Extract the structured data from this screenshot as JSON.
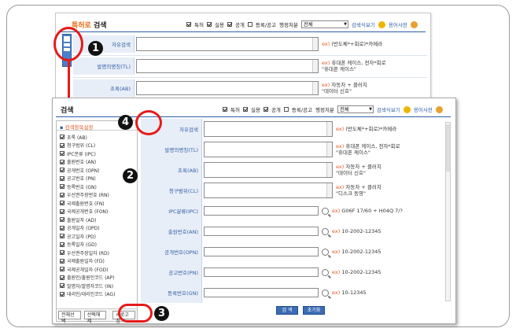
{
  "back_window": {
    "logo": "특허로",
    "title": "검색",
    "options": {
      "opt1": "특허",
      "opt2": "실용",
      "opt3": "공개",
      "opt4": "등록/공고",
      "status_label": "행정처분",
      "status_value": "전체"
    },
    "link1": "검색식보기",
    "link2": "용어사전",
    "fields": [
      {
        "label": "자유검색",
        "hint": "(반도체*+회로)*카메라",
        "sub": ""
      },
      {
        "label": "발명의명칭(TL)",
        "hint": "휴대폰 케이스, 전자*회로",
        "sub": "\"휴대폰 케이스\""
      },
      {
        "label": "초록(AB)",
        "hint": "자동차 + 클러치",
        "sub": "\"데이터 신호\""
      }
    ]
  },
  "front_window": {
    "title": "검색",
    "options": {
      "opt1": "특허",
      "opt2": "실용",
      "opt3": "공개",
      "opt4": "등록/공고",
      "status_label": "행정처분",
      "status_value": "전체"
    },
    "link1": "검색식보기",
    "link2": "용어사전",
    "sidebar": {
      "header": "검색항목설정",
      "items": [
        "초록 (AB)",
        "청구범위 (CL)",
        "IPC분류 (IPC)",
        "출원번호 (AN)",
        "공개번호 (OPN)",
        "공고번호 (PN)",
        "등록번호 (GN)",
        "우선권주장번호 (RN)",
        "국제출원번호 (FN)",
        "국제공개번호 (FON)",
        "출원일자 (AD)",
        "공개일자 (OPD)",
        "공고일자 (PD)",
        "등록일자 (GD)",
        "우선권주장일자 (RD)",
        "국제출원일자 (FD)",
        "국제공개일자 (FOD)",
        "출원인/출원인코드 (AP)",
        "발명자/발명자코드 (IN)",
        "대리인/대리인코드 (AG)"
      ],
      "btn_all": "전체선택",
      "btn_apply": "선택해제",
      "btn_reset": "새로고침"
    },
    "fields": [
      {
        "label": "자유검색",
        "hint": "(반도체*+회로)*카메라",
        "sub": ""
      },
      {
        "label": "발명의명칭(TL)",
        "hint": "휴대폰 케이스, 전자*회로",
        "sub": "\"휴대폰 케이스\""
      },
      {
        "label": "초록(AB)",
        "hint": "자동차 + 클러치",
        "sub": "\"데이터 신호\""
      },
      {
        "label": "청구범위(CL)",
        "hint": "자동차 + 클러치",
        "sub": "\"디스크 동영\""
      },
      {
        "label": "IPC분류(IPC)",
        "hint": "G06F 17/60 + H04Q 7/?",
        "sub": ""
      },
      {
        "label": "출원번호(AN)",
        "hint": "10-2002-12345",
        "sub": ""
      },
      {
        "label": "공개번호(OPN)",
        "hint": "10-2002-12345",
        "sub": ""
      },
      {
        "label": "공고번호(PN)",
        "hint": "10-2002-12345",
        "sub": ""
      },
      {
        "label": "등록번호(GN)",
        "hint": "10-12345",
        "sub": ""
      }
    ],
    "search_btn": "검 색",
    "cancel_btn": "초기화"
  },
  "callouts": {
    "c1": "1",
    "c2": "2",
    "c3": "3",
    "c4": "4"
  },
  "colors": {
    "accent": "#2f5fa8",
    "highlight": "#e61a1a",
    "label_bg": "#e8eef7"
  }
}
